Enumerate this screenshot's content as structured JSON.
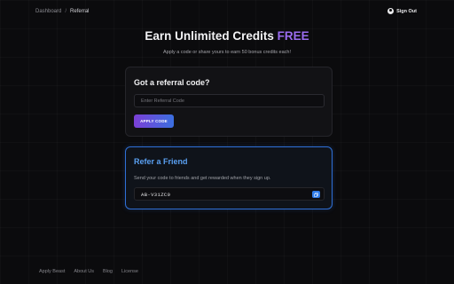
{
  "breadcrumb": {
    "parent": "Dashboard",
    "separator": "/",
    "current": "Referral"
  },
  "header": {
    "signout_label": "Sign Out",
    "signout_icon": "user-circle-icon"
  },
  "hero": {
    "title_main": "Earn Unlimited Credits",
    "title_accent": "FREE",
    "subtitle": "Apply a code or share yours to earn 50 bonus credits each!"
  },
  "referral_card": {
    "title": "Got a referral code?",
    "input_placeholder": "Enter Referral Code",
    "input_value": "",
    "apply_label": "APPLY CODE"
  },
  "refer_card": {
    "title": "Refer a Friend",
    "description": "Send your code to friends and get rewarded when they sign up.",
    "code": "AB-V31ZC0",
    "copy_icon": "copy-icon"
  },
  "footer": {
    "links": [
      "Apply Beast",
      "About Us",
      "Blog",
      "License"
    ]
  },
  "colors": {
    "accent_purple": "#9a6cf0",
    "accent_blue": "#2f7be8",
    "background": "#0b0b0d"
  }
}
